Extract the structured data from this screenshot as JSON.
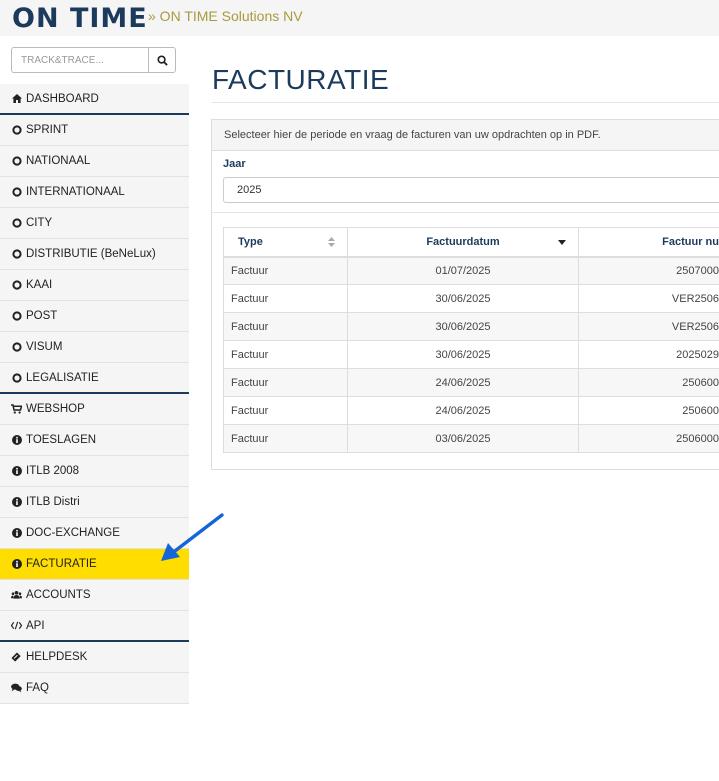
{
  "header": {
    "logo": "ON TIME",
    "breadcrumb": "» ON TIME Solutions NV"
  },
  "sidebar": {
    "search_placeholder": "TRACK&TRACE...",
    "items": [
      {
        "label": "DASHBOARD",
        "icon": "home-icon"
      },
      {
        "label": "SPRINT",
        "icon": "circle-o-icon"
      },
      {
        "label": "NATIONAAL",
        "icon": "circle-o-icon"
      },
      {
        "label": "INTERNATIONAAL",
        "icon": "circle-o-icon"
      },
      {
        "label": "CITY",
        "icon": "circle-o-icon"
      },
      {
        "label": "DISTRIBUTIE (BeNeLux)",
        "icon": "circle-o-icon"
      },
      {
        "label": "KAAI",
        "icon": "circle-o-icon"
      },
      {
        "label": "POST",
        "icon": "circle-o-icon"
      },
      {
        "label": "VISUM",
        "icon": "circle-o-icon"
      },
      {
        "label": "LEGALISATIE",
        "icon": "circle-o-icon"
      },
      {
        "label": "WEBSHOP",
        "icon": "shopping-cart-icon"
      },
      {
        "label": "TOESLAGEN",
        "icon": "info-circle-icon"
      },
      {
        "label": "ITLB 2008",
        "icon": "info-circle-icon"
      },
      {
        "label": "ITLB Distri",
        "icon": "info-circle-icon"
      },
      {
        "label": "DOC-EXCHANGE",
        "icon": "info-circle-icon"
      },
      {
        "label": "FACTURATIE",
        "icon": "info-circle-icon"
      },
      {
        "label": "ACCOUNTS",
        "icon": "users-icon"
      },
      {
        "label": "API",
        "icon": "code-icon"
      },
      {
        "label": "HELPDESK",
        "icon": "ticket-icon"
      },
      {
        "label": "FAQ",
        "icon": "comments-icon"
      }
    ]
  },
  "main": {
    "title": "FACTURATIE",
    "panel_heading": "Selecteer hier de periode en vraag de facturen van uw opdrachten op in PDF.",
    "filter_label": "Jaar",
    "year_value": "2025",
    "table": {
      "columns": [
        "Type",
        "Factuurdatum",
        "Factuur nu"
      ],
      "rows": [
        [
          "Factuur",
          "01/07/2025",
          "2507000"
        ],
        [
          "Factuur",
          "30/06/2025",
          "VER2506"
        ],
        [
          "Factuur",
          "30/06/2025",
          "VER2506"
        ],
        [
          "Factuur",
          "30/06/2025",
          "2025029"
        ],
        [
          "Factuur",
          "24/06/2025",
          "250600"
        ],
        [
          "Factuur",
          "24/06/2025",
          "250600"
        ],
        [
          "Factuur",
          "03/06/2025",
          "2506000"
        ]
      ]
    }
  },
  "colors": {
    "brand_navy": "#1b3a5c",
    "brand_gold": "#a89a3e",
    "active_yellow": "#ffdd00",
    "arrow_blue": "#1565d8"
  }
}
